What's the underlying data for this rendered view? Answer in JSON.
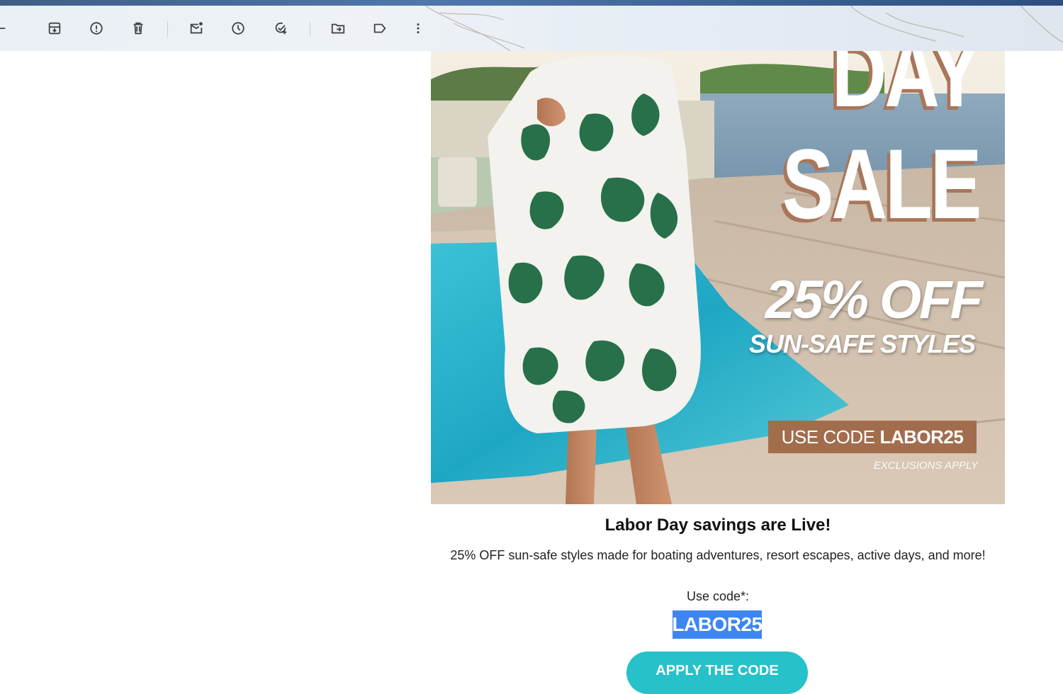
{
  "toolbar": {
    "buttons": [
      {
        "name": "back",
        "icon": "arrow-left-icon"
      },
      {
        "name": "archive",
        "icon": "archive-icon"
      },
      {
        "name": "report-spam",
        "icon": "report-icon"
      },
      {
        "name": "delete",
        "icon": "trash-icon"
      },
      {
        "name": "mark-unread",
        "icon": "mail-unread-icon"
      },
      {
        "name": "snooze",
        "icon": "clock-icon"
      },
      {
        "name": "add-to-tasks",
        "icon": "task-add-icon"
      },
      {
        "name": "move-to",
        "icon": "folder-move-icon"
      },
      {
        "name": "label",
        "icon": "label-icon"
      },
      {
        "name": "more",
        "icon": "more-vert-icon"
      }
    ]
  },
  "email": {
    "hero": {
      "title_line1": "DAY",
      "title_line2": "SALE",
      "discount": "25% OFF",
      "discount_sub": "SUN-SAFE STYLES",
      "code_prefix": "USE CODE",
      "code_value": "LABOR25",
      "exclusions": "EXCLUSIONS APPLY"
    },
    "headline": "Labor Day savings are Live!",
    "body": "25% OFF sun-safe styles made for boating adventures, resort escapes, active days, and more!",
    "code_label": "Use code*:",
    "code": "LABOR25",
    "cta": "APPLY THE CODE"
  },
  "colors": {
    "code_highlight": "#3d86f1",
    "cta_background": "#27c1c9",
    "code_box": "#a26d4d",
    "title_shadow": "#a8765a"
  }
}
